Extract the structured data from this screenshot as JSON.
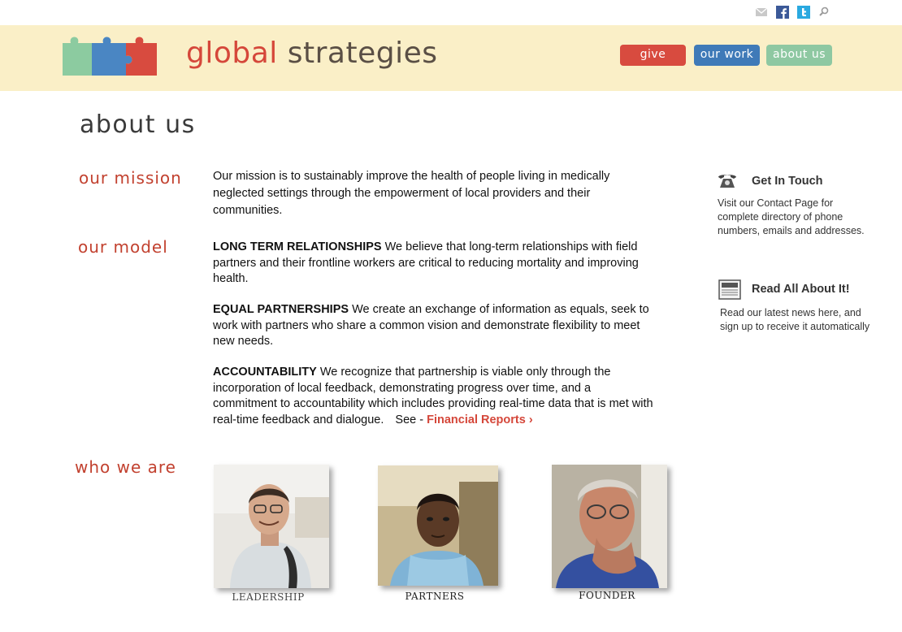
{
  "header": {
    "logo_part1": "global",
    "logo_part2": "strategies",
    "nav": {
      "give": "give",
      "our_work": "our work",
      "about_us": "about us"
    }
  },
  "social_icons": [
    "mail-icon",
    "facebook-icon",
    "twitter-icon",
    "search-icon"
  ],
  "page": {
    "title": "about us",
    "mission_heading": "our mission",
    "mission_text": "Our mission is to sustainably improve the health of people living in medically neglected settings through the empowerment of local providers and their communities.",
    "model_heading": "our model",
    "model": [
      {
        "title": "LONG TERM RELATIONSHIPS",
        "text": " We believe that long-term relationships with field partners and their frontline workers are critical to reducing mortality and improving health."
      },
      {
        "title": "EQUAL PARTNERSHIPS",
        "text": " We create an exchange of information as equals, seek to work with partners who share a common vision and demonstrate flexibility to meet new needs."
      },
      {
        "title": "ACCOUNTABILITY",
        "text": " We recognize that partnership is viable only through the incorporation of local feedback, demonstrating progress over time, and a commitment to accountability which includes providing real-time data that is met with real-time feedback and dialogue."
      }
    ],
    "see_label": "See -",
    "financial_link": "Financial Reports ›",
    "who_heading": "who we are",
    "people": [
      {
        "caption": "LEADERSHIP"
      },
      {
        "caption": "PARTNERS"
      },
      {
        "caption": "FOUNDER"
      }
    ]
  },
  "sidebar": {
    "contact_title": "Get In Touch",
    "contact_text": "Visit our Contact Page for complete directory of phone numbers, emails and addresses.",
    "news_title": "Read All About It!",
    "news_text": "Read our latest news here, and sign up to receive it automatically"
  },
  "colors": {
    "header_bg": "#faefc7",
    "accent_red": "#d5473a",
    "nav_give": "#d84b3f",
    "nav_work": "#3f7ab8",
    "nav_about": "#8ec8a2"
  }
}
